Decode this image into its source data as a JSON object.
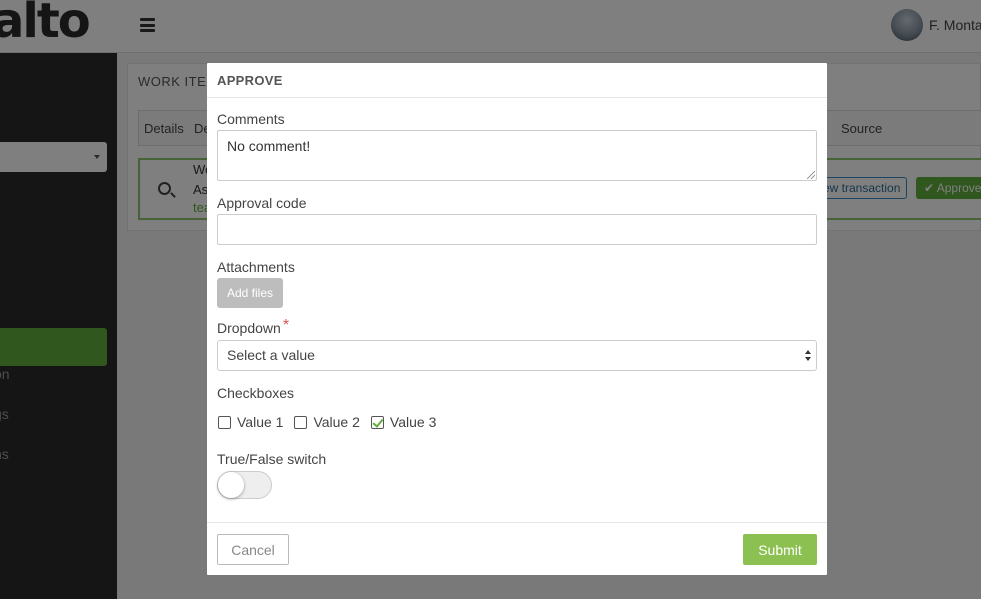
{
  "app": {
    "logo_text": "alto",
    "user_name": "F. Monta",
    "sidebar_links": [
      "on",
      "gs",
      "ns"
    ]
  },
  "work_items": {
    "title": "WORK ITEI",
    "columns": [
      "Details",
      "De",
      "Source"
    ],
    "row_lines": [
      "Wo",
      "As",
      "tea"
    ],
    "view_transaction_label": "ew transaction",
    "approve_label": "✔ Approve"
  },
  "modal": {
    "title": "APPROVE",
    "comments": {
      "label": "Comments",
      "value": "No comment!"
    },
    "approval_code": {
      "label": "Approval code",
      "value": ""
    },
    "attachments": {
      "label": "Attachments",
      "button": "Add files"
    },
    "dropdown": {
      "label": "Dropdown",
      "required_mark": "*",
      "selected": "Select a value"
    },
    "checkboxes": {
      "label": "Checkboxes",
      "items": [
        {
          "label": "Value 1",
          "checked": false
        },
        {
          "label": "Value 2",
          "checked": false
        },
        {
          "label": "Value 3",
          "checked": true
        }
      ]
    },
    "switch": {
      "label": "True/False switch",
      "on": false
    },
    "footer": {
      "cancel": "Cancel",
      "submit": "Submit"
    }
  },
  "colors": {
    "accent_green": "#8cc152",
    "brand_green": "#5fae3c",
    "required_red": "#d9534f"
  }
}
